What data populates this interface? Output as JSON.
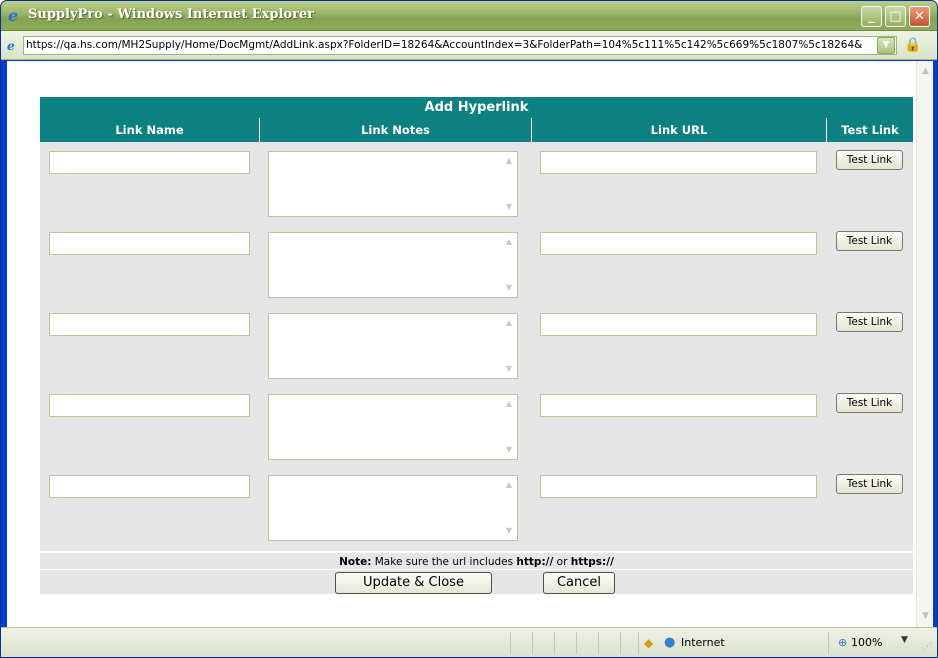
{
  "window": {
    "title": "SupplyPro - Windows Internet Explorer",
    "address": "https://qa.hs.com/MH2Supply/Home/DocMgmt/AddLink.aspx?FolderID=18264&AccountIndex=3&FolderPath=104%5c111%5c142%5c669%5c1807%5c18264&"
  },
  "form": {
    "title": "Add Hyperlink",
    "columns": [
      "Link Name",
      "Link Notes",
      "Link URL",
      "Test Link"
    ],
    "rows": [
      {
        "name": "",
        "notes": "",
        "url": "",
        "test_label": "Test Link"
      },
      {
        "name": "",
        "notes": "",
        "url": "",
        "test_label": "Test Link"
      },
      {
        "name": "",
        "notes": "",
        "url": "",
        "test_label": "Test Link"
      },
      {
        "name": "",
        "notes": "",
        "url": "",
        "test_label": "Test Link"
      },
      {
        "name": "",
        "notes": "",
        "url": "",
        "test_label": "Test Link"
      }
    ],
    "note_label": "Note:",
    "note_text": "Make sure the url includes",
    "note_http": "http://",
    "note_or": "or",
    "note_https": "https://",
    "update_label": "Update & Close",
    "cancel_label": "Cancel"
  },
  "statusbar": {
    "zone": "Internet",
    "zoom": "100%"
  },
  "icons": {
    "browser": "ie-icon",
    "lock": "lock-icon",
    "globe": "globe-icon",
    "zoom": "magnifier-icon"
  }
}
